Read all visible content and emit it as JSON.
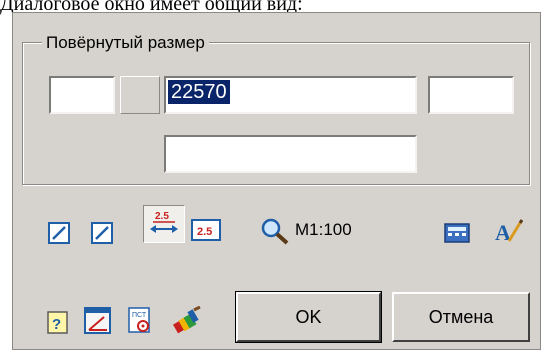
{
  "caption": "Диалоговое окно имеет общий вид:",
  "group": {
    "title": "Повёрнутый размер"
  },
  "fields": {
    "prefix_value": "",
    "main_value": "22570",
    "suffix_value": "",
    "bottom_value": ""
  },
  "toolbar": {
    "scale_label": "M1:100",
    "icons": [
      "arrow-left-edit-icon",
      "arrow-right-edit-icon",
      "text-position-25-icon",
      "text-value-25-icon",
      "magnifier-icon",
      "calculator-icon",
      "text-style-icon"
    ]
  },
  "bottom": {
    "ok_label": "OK",
    "cancel_label": "Отмена",
    "icons": [
      "help-icon",
      "angle-dimension-icon",
      "spec-icon",
      "properties-icon",
      "paint-icon"
    ]
  },
  "colors": {
    "dialog_bg": "#d6d3ce",
    "selection_bg": "#0a246a",
    "icon_blue": "#1f5fa8",
    "icon_red": "#c8201e"
  }
}
